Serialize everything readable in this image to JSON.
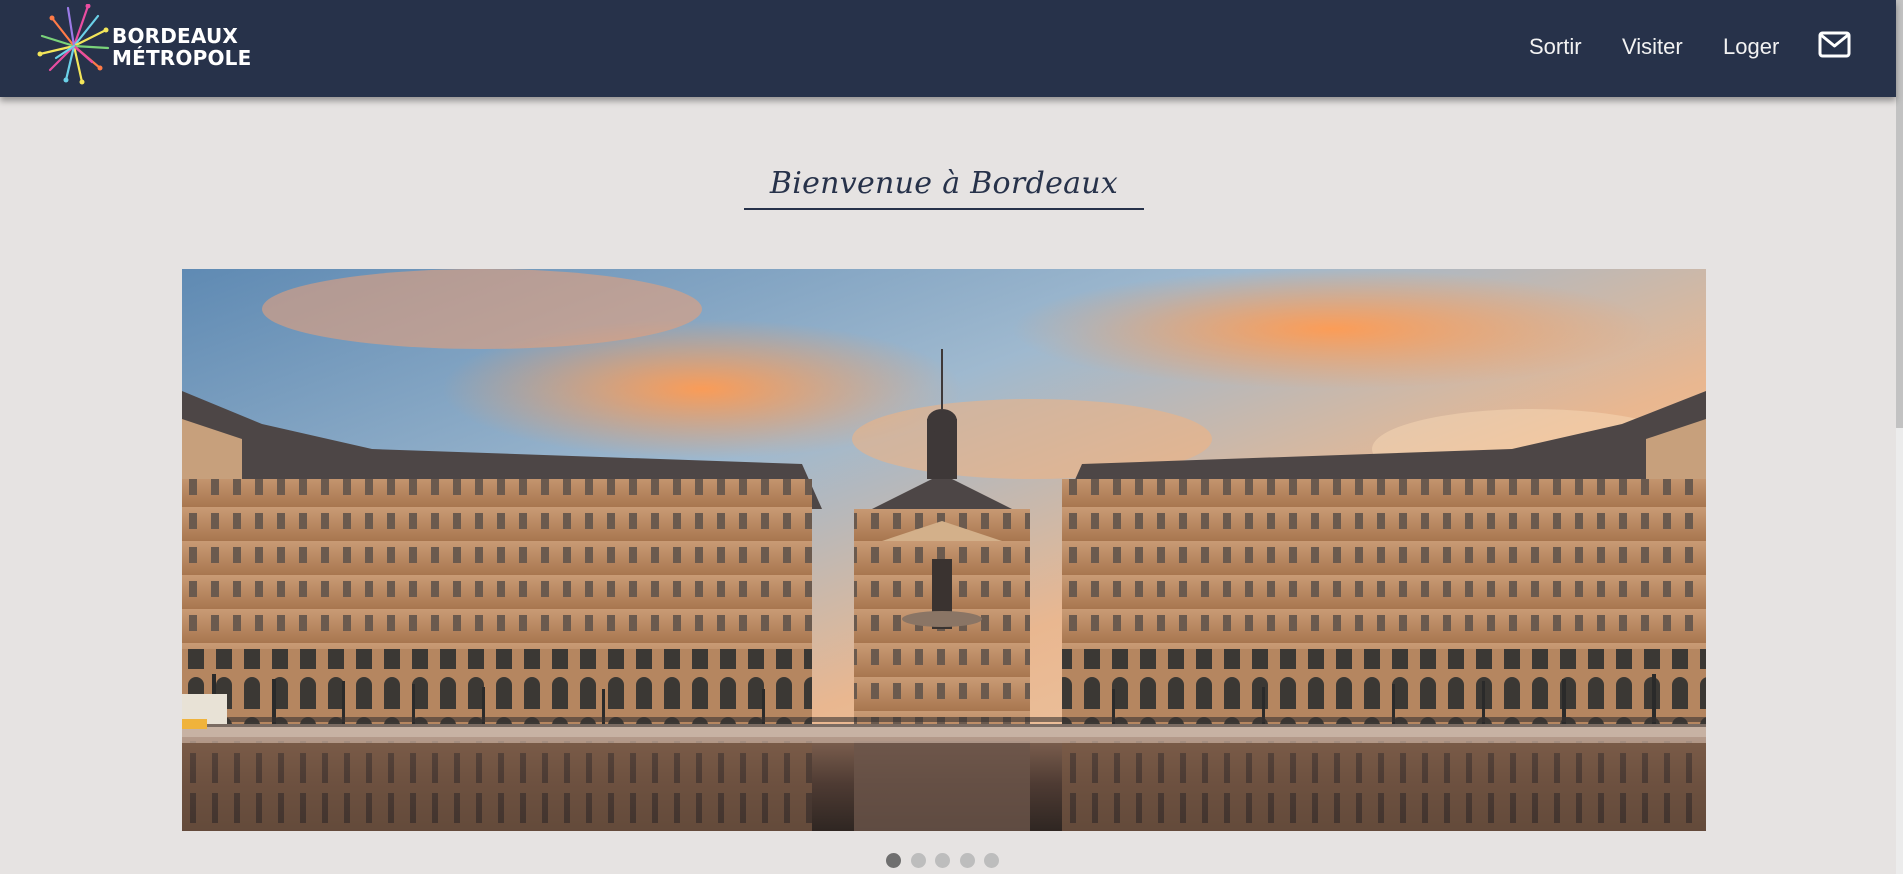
{
  "header": {
    "logo_line1": "BORDEAUX",
    "logo_line2": "MÉTROPOLE",
    "nav": [
      {
        "label": "Sortir"
      },
      {
        "label": "Visiter"
      },
      {
        "label": "Loger"
      }
    ],
    "contact_icon": "envelope-icon",
    "colors": {
      "background": "#27324a",
      "text": "#ffffff"
    }
  },
  "main": {
    "title": "Bienvenue à Bordeaux",
    "carousel": {
      "slide_count": 5,
      "active_index": 0,
      "current_slide": "Place de la Bourse with Miroir d'eau at sunset"
    }
  },
  "colors": {
    "page_background": "#e6e3e2",
    "accent": "#27324a"
  }
}
